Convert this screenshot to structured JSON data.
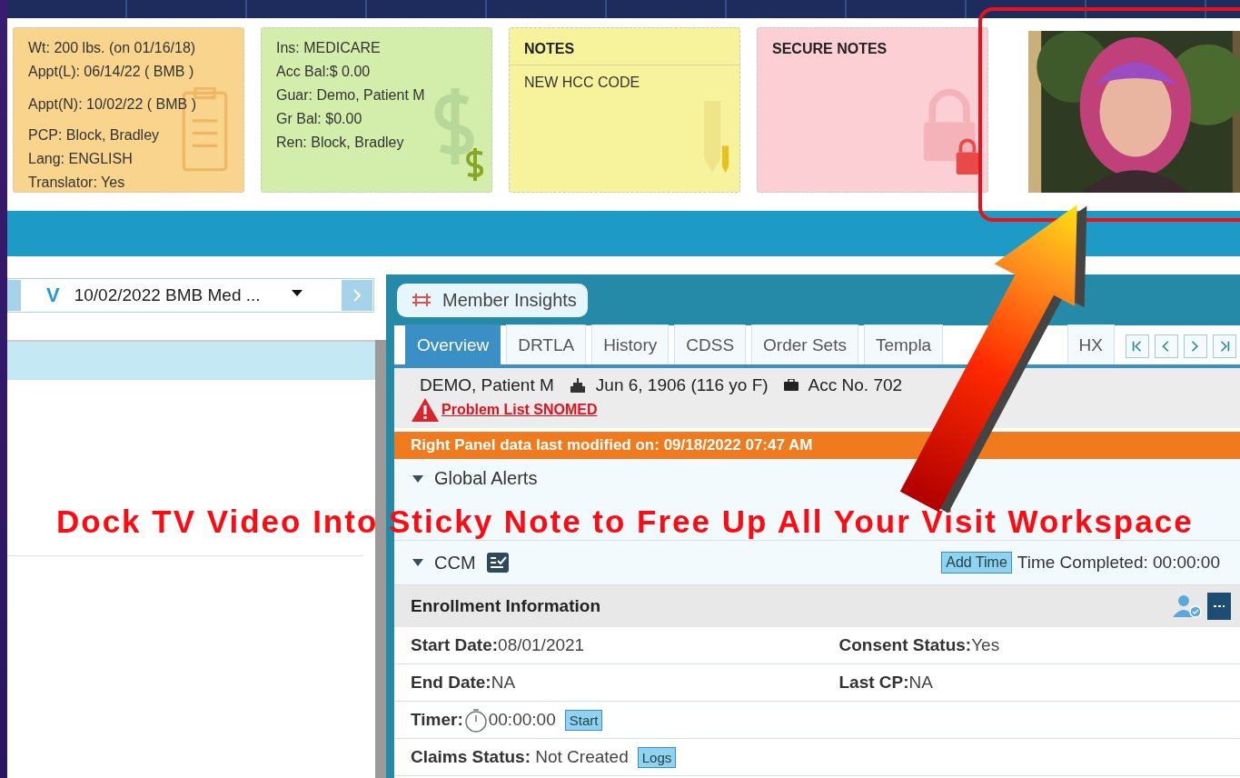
{
  "caption": "Dock TV Video Into Sticky Note to Free Up All Your Visit Workspace",
  "sticky_notes": [
    {
      "kind": "info",
      "lines": [
        "Wt: 200 lbs. (on 01/16/18)",
        "Appt(L): 06/14/22 ( BMB )",
        "Appt(N): 10/02/22 ( BMB )",
        "PCP: Block, Bradley",
        "Lang: ENGLISH",
        "Translator: Yes"
      ]
    },
    {
      "kind": "billing",
      "lines": [
        "Ins: MEDICARE",
        "Acc Bal:$ 0.00",
        "Guar: Demo, Patient M",
        "Gr Bal: $0.00",
        "Ren: Block, Bradley"
      ]
    },
    {
      "kind": "notes",
      "title": "NOTES",
      "lines": [
        "NEW HCC CODE"
      ]
    },
    {
      "kind": "secure",
      "title": "SECURE NOTES"
    },
    {
      "kind": "video"
    }
  ],
  "visit_selector": {
    "letter": "V",
    "value": "10/02/2022 BMB Med ..."
  },
  "member_insights": {
    "title": "Member Insights",
    "tabs": [
      {
        "label": "Overview",
        "selected": true
      },
      {
        "label": "DRTLA",
        "selected": false
      },
      {
        "label": "History",
        "selected": false
      },
      {
        "label": "CDSS",
        "selected": false
      },
      {
        "label": "Order Sets",
        "selected": false
      },
      {
        "label": "Templa",
        "selected": false
      },
      {
        "label": "HX",
        "selected": false
      }
    ],
    "patient": {
      "name": "DEMO, Patient M",
      "dob": "Jun 6, 1906 (116 yo F)",
      "account": "Acc No. 702"
    },
    "problem_link": "Problem List SNOMED",
    "banner": "Right Panel data last modified on: 09/18/2022 07:47 AM",
    "sections": [
      {
        "title": "Global Alerts",
        "expanded": true
      },
      {
        "title": "CCM",
        "expanded": true
      }
    ],
    "add_time": "Add Time",
    "time_completed": "Time Completed: 00:00:00",
    "enrollment": {
      "title": "Enrollment Information",
      "rows": [
        [
          {
            "label": "Start Date:",
            "value": "08/01/2021"
          },
          {
            "label": "Consent Status:",
            "value": "Yes"
          }
        ],
        [
          {
            "label": "End Date:",
            "value": "NA"
          },
          {
            "label": "Last CP:",
            "value": "NA"
          }
        ],
        [
          {
            "label": "Timer:",
            "value": "00:00:00",
            "kind": "timer",
            "button": "Start"
          }
        ],
        [
          {
            "label": "Claims Status: ",
            "value": "Not Created",
            "button": "Logs"
          }
        ]
      ]
    }
  }
}
